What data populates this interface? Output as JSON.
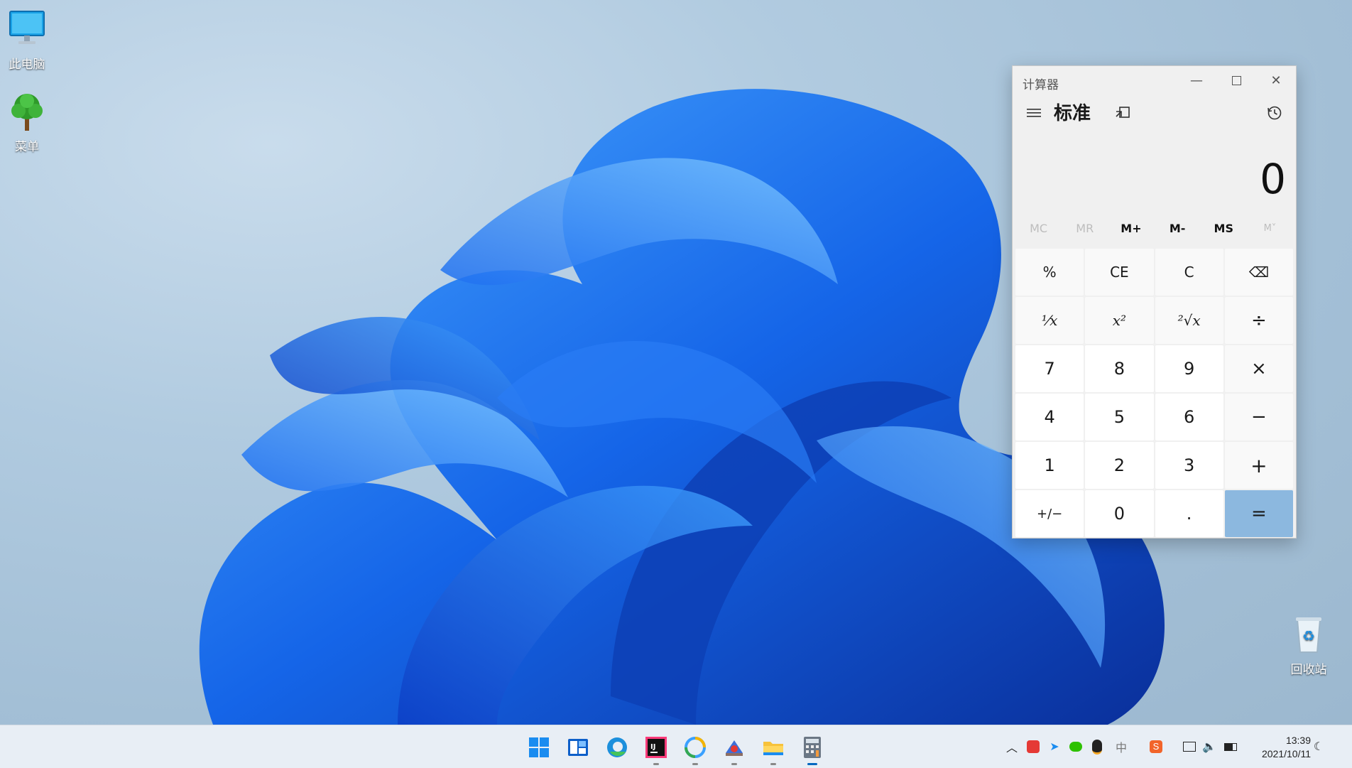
{
  "desktop": {
    "icons": [
      {
        "label": "此电脑",
        "icon": "monitor-icon"
      },
      {
        "label": "菜单",
        "icon": "tree-icon"
      },
      {
        "label": "回收站",
        "icon": "recycle-bin-icon"
      }
    ]
  },
  "calculator": {
    "title": "计算器",
    "mode": "标准",
    "display": "0",
    "memory": {
      "disabled": [
        "MC",
        "MR"
      ],
      "enabled": [
        "M+",
        "M-",
        "MS"
      ],
      "store_list": "M˅"
    },
    "keys": [
      [
        "%",
        "CE",
        "C",
        "⌫"
      ],
      [
        "⅟x",
        "x²",
        "²√x",
        "÷"
      ],
      [
        "7",
        "8",
        "9",
        "×"
      ],
      [
        "4",
        "5",
        "6",
        "−"
      ],
      [
        "1",
        "2",
        "3",
        "+"
      ],
      [
        "+/−",
        "0",
        ".",
        "="
      ]
    ],
    "accent": "#8cb8df"
  },
  "taskbar": {
    "apps": [
      "start-icon",
      "widgets-icon",
      "edge-icon",
      "intellij-icon",
      "browser-icon",
      "pinball-icon",
      "file-explorer-icon",
      "calculator-icon"
    ],
    "clock": {
      "time": "13:39",
      "date": "2021/10/11"
    }
  }
}
